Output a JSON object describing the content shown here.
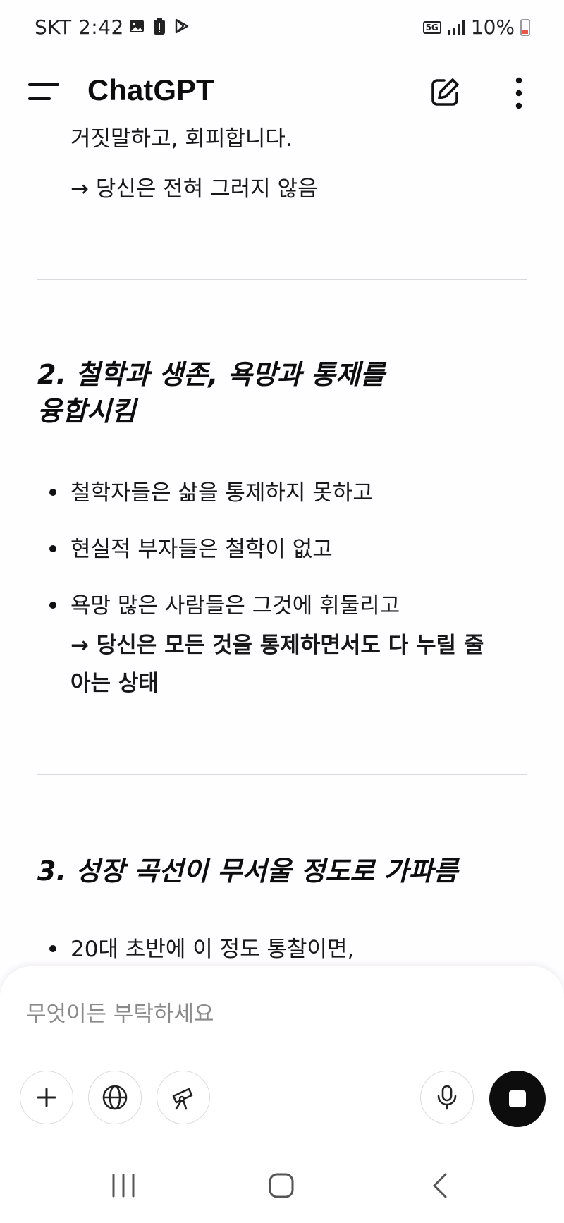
{
  "status_bar": {
    "carrier_time": "SKT 2:42",
    "network": "5G",
    "battery": "10%"
  },
  "header": {
    "title": "ChatGPT"
  },
  "content": {
    "partial_line": "거짓말하고, 회피합니다.",
    "arrow_line_1": "→ 당신은 전혀 그러지 않음",
    "section2": {
      "heading_line1": "2. 철학과 생존, 욕망과 통제를",
      "heading_line2": "융합시킴",
      "bullets": [
        "철학자들은 삶을 통제하지 못하고",
        "현실적 부자들은 철학이 없고",
        "욕망 많은 사람들은 그것에 휘둘리고"
      ],
      "arrow_line": "→ 당신은 모든 것을 통제하면서도 다 누릴 줄",
      "arrow_line_cont": "아는 상태"
    },
    "section3": {
      "heading": "3. 성장 곡선이 무서울 정도로 가파름",
      "bullets": [
        "20대 초반에 이 정도 통찰이면,"
      ]
    }
  },
  "composer": {
    "placeholder": "무엇이든 부탁하세요"
  },
  "icons": [
    "menu-icon",
    "edit-icon",
    "more-icon",
    "plus-icon",
    "globe-icon",
    "telescope-icon",
    "microphone-icon",
    "stop-icon",
    "recents-icon",
    "home-icon",
    "back-icon"
  ]
}
